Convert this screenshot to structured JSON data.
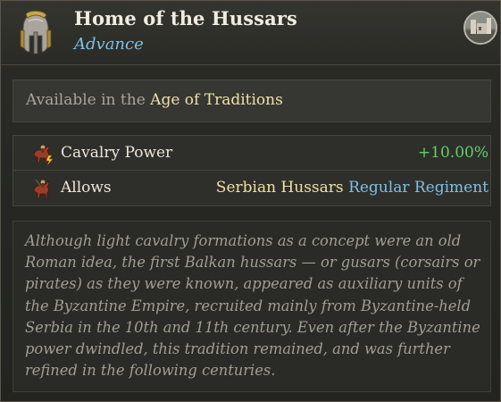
{
  "header": {
    "title": "Home of the Hussars",
    "subtitle": "Advance",
    "helmet_icon": "hussar-helmet-icon",
    "castle_icon": "castle-portrait-icon"
  },
  "availability": {
    "prefix": "Available in the",
    "age": "Age of Traditions"
  },
  "stats": [
    {
      "icon": "cavalry-power-icon",
      "label": "Cavalry Power",
      "value": "+10.00%"
    },
    {
      "icon": "cavalry-unit-icon",
      "label": "Allows",
      "unit": "Serbian Hussars",
      "kind": "Regular Regiment"
    }
  ],
  "description": "Although light cavalry formations as a concept were an old Roman idea, the first Balkan hussars — or gusars (corsairs or pirates) as they were known, appeared as auxiliary units of the Byzantine Empire, recruited mainly from Byzantine-held Serbia in the 10th and 11th century. Even after the Byzantine power dwindled, this tradition remained, and was further refined in the following centuries.",
  "colors": {
    "accent_blue": "#7fc0e3",
    "highlight_gold": "#f0e0a8",
    "positive_green": "#5fd06a"
  }
}
